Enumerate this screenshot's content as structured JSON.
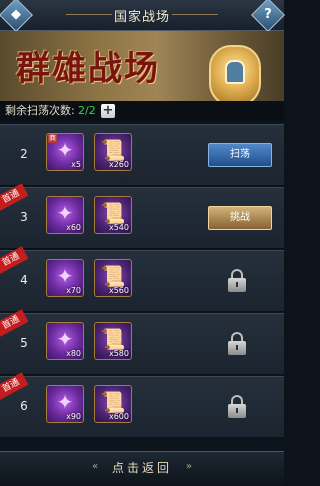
{
  "header": {
    "title": "国家战场"
  },
  "banner": {
    "title": "群雄战场"
  },
  "remaining": {
    "label": "剩余扫荡次数:",
    "value": "2/2"
  },
  "rows": [
    {
      "num": "2",
      "first_pass": "",
      "item1_badge": "商",
      "item1_qty": "x5",
      "item2_qty": "x260",
      "action": "扫荡"
    },
    {
      "num": "3",
      "first_pass": "首通",
      "item1_badge": "",
      "item1_qty": "x60",
      "item2_qty": "x540",
      "action": "挑战"
    },
    {
      "num": "4",
      "first_pass": "首通",
      "item1_badge": "",
      "item1_qty": "x70",
      "item2_qty": "x560",
      "action": ""
    },
    {
      "num": "5",
      "first_pass": "首通",
      "item1_badge": "",
      "item1_qty": "x80",
      "item2_qty": "x580",
      "action": ""
    },
    {
      "num": "6",
      "first_pass": "首通",
      "item1_badge": "",
      "item1_qty": "x90",
      "item2_qty": "x600",
      "action": ""
    }
  ],
  "footer": {
    "back_label": "点击返回"
  },
  "icons": {
    "corner_left": "gem-icon",
    "corner_right": "info-icon",
    "purple_item": "crystal-icon",
    "scroll_item": "scroll-icon",
    "lock": "lock-icon"
  },
  "colors": {
    "remain_value": "#39d34a",
    "first_pass": "#c41d1d",
    "sweep_button": "#2f68ad",
    "challenge_button": "#b08a52"
  }
}
